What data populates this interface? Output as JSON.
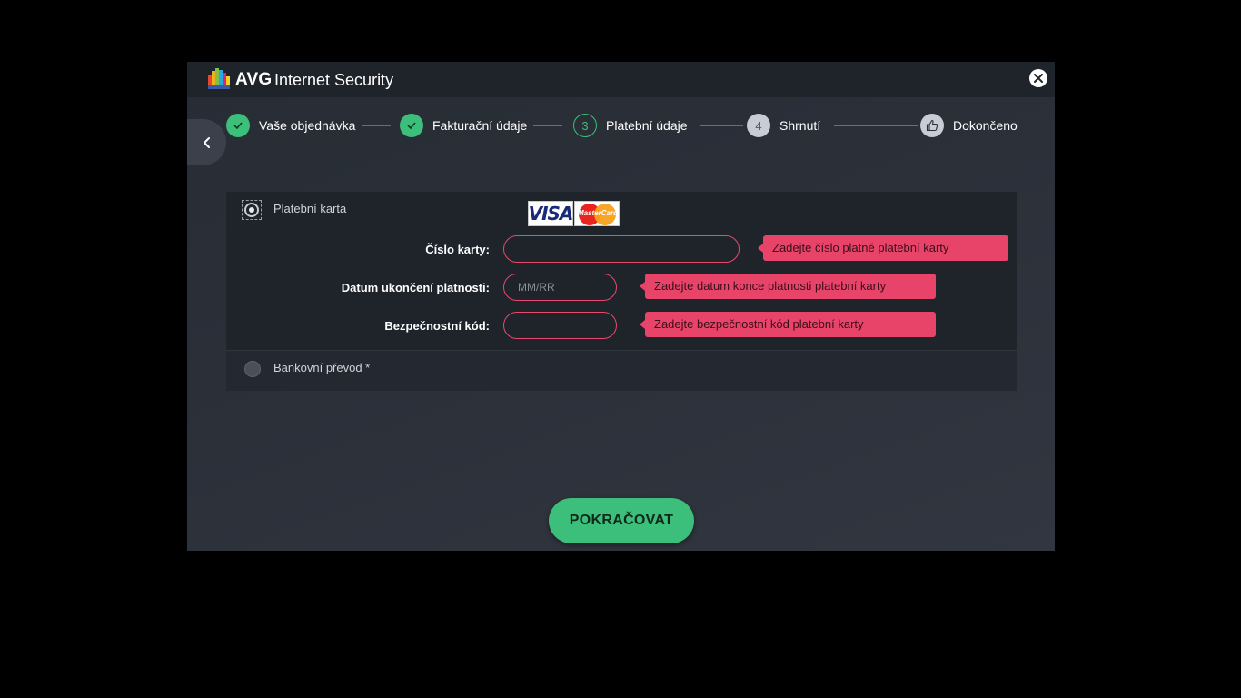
{
  "app": {
    "brand": "AVG",
    "product": "Internet Security",
    "logo_icon": "avg-logo-icon",
    "close_icon": "close-icon"
  },
  "colors": {
    "accent_green": "#3cbf7a",
    "error_pink": "#e8446a",
    "window_bg": "#2a2f38"
  },
  "stepper": {
    "steps": [
      {
        "label": "Vaše objednávka",
        "status": "done",
        "marker": "✓"
      },
      {
        "label": "Fakturační údaje",
        "status": "done",
        "marker": "✓"
      },
      {
        "label": "Platební údaje",
        "status": "current",
        "marker": "3"
      },
      {
        "label": "Shrnutí",
        "status": "todo",
        "marker": "4"
      },
      {
        "label": "Dokončeno",
        "status": "todo",
        "marker": "thumbs-up-icon"
      }
    ]
  },
  "payment": {
    "card_option": {
      "label": "Platební karta",
      "selected": true,
      "logos": {
        "visa": "VISA",
        "mastercard": "MasterCard"
      }
    },
    "fields": {
      "card_number": {
        "label": "Číslo karty:",
        "value": "",
        "placeholder": "",
        "error": "Zadejte číslo platné platební karty"
      },
      "expiry": {
        "label": "Datum ukončení platnosti:",
        "value": "",
        "placeholder": "MM/RR",
        "error": "Zadejte datum konce platnosti platební karty"
      },
      "security_code": {
        "label": "Bezpečnostní kód:",
        "value": "",
        "placeholder": "",
        "error": "Zadejte bezpečnostní kód platební karty"
      }
    },
    "bank_option": {
      "label": "Bankovní převod *",
      "selected": false
    }
  },
  "actions": {
    "continue_label": "POKRAČOVAT"
  }
}
